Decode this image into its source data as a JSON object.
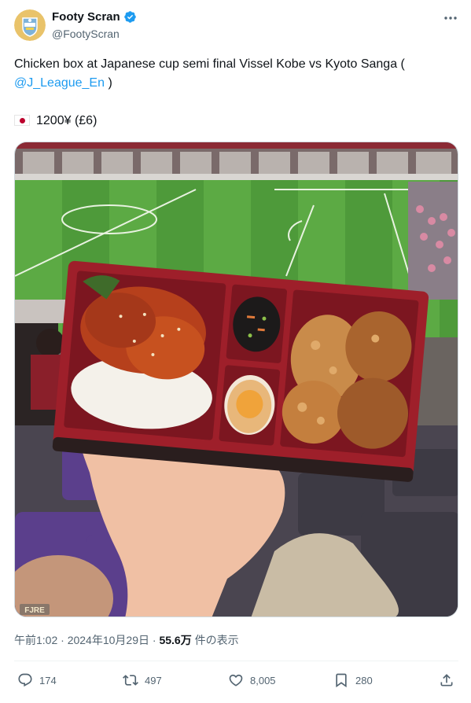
{
  "author": {
    "name": "Footy Scran",
    "handle": "@FootyScran",
    "verified": true,
    "avatar_icon": "footy-scran-logo-icon"
  },
  "tweet": {
    "text_line1": "Chicken box at Japanese cup semi final Vissel Kobe vs Kyoto Sanga (",
    "mention": "@J_League_En",
    "text_line2_suffix": " )",
    "price_flag": "japan-flag-icon",
    "price": "1200¥ (£6)"
  },
  "media": {
    "watermark": "FJRE",
    "description_icon": "bento-photo"
  },
  "meta": {
    "time": "午前1:02",
    "sep": " · ",
    "date": "2024年10月29日",
    "views_count": "55.6万",
    "views_label": " 件の表示"
  },
  "actions": {
    "replies": "174",
    "reposts": "497",
    "likes": "8,005",
    "bookmarks": "280"
  },
  "colors": {
    "accent": "#1d9bf0",
    "text": "#0f1419",
    "secondary": "#536471"
  }
}
